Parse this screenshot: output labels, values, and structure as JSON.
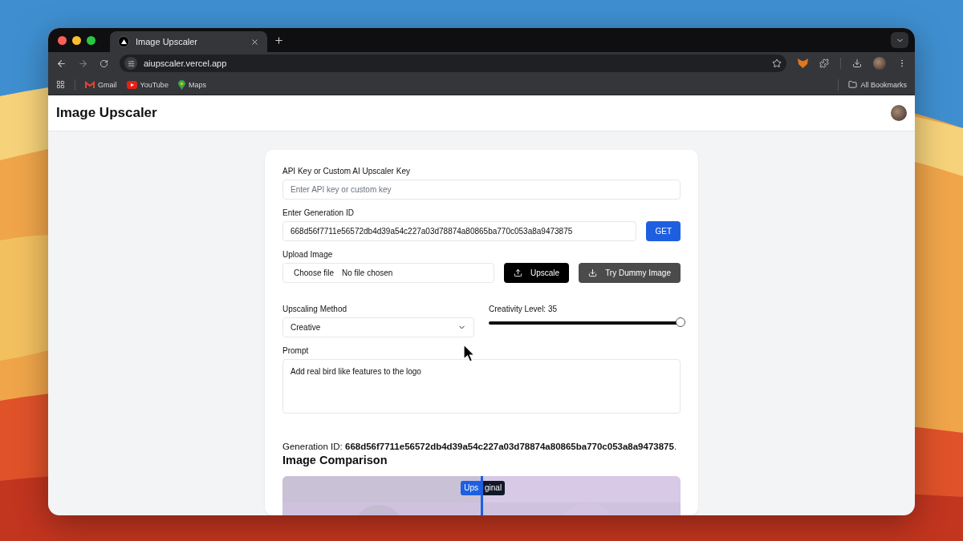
{
  "browser": {
    "tabs": [
      {
        "title": "Image Upscaler",
        "selected": true
      }
    ],
    "address": "aiupscaler.vercel.app",
    "bookmarks": [
      {
        "label": "Gmail"
      },
      {
        "label": "YouTube"
      },
      {
        "label": "Maps"
      }
    ],
    "all_bookmarks": "All Bookmarks"
  },
  "page": {
    "title": "Image Upscaler",
    "api_key": {
      "label": "API Key or Custom AI Upscaler Key",
      "placeholder": "Enter API key or custom key"
    },
    "generation": {
      "label": "Enter Generation ID",
      "value": "668d56f7711e56572db4d39a54c227a03d78874a80865ba770c053a8a9473875",
      "button": "GET"
    },
    "upload": {
      "label": "Upload Image",
      "choose": "Choose file",
      "status": "No file chosen",
      "upscale": "Upscale",
      "dummy": "Try Dummy Image"
    },
    "method": {
      "label": "Upscaling Method",
      "value": "Creative"
    },
    "creativity": {
      "label": "Creativity Level: 35",
      "level": 1
    },
    "prompt": {
      "label": "Prompt",
      "value": "Add real bird like features to the logo"
    },
    "result": "Generation ID: **668d56f7711e56572db4d39a54c227a03d78874a80865ba770c053a8a9473875**.",
    "comparison": {
      "title": "Image Comparison",
      "labels": [
        {
          "text": "Ups",
          "kind": "upscaled"
        },
        {
          "text": "ginal",
          "kind": "original"
        }
      ]
    }
  }
}
